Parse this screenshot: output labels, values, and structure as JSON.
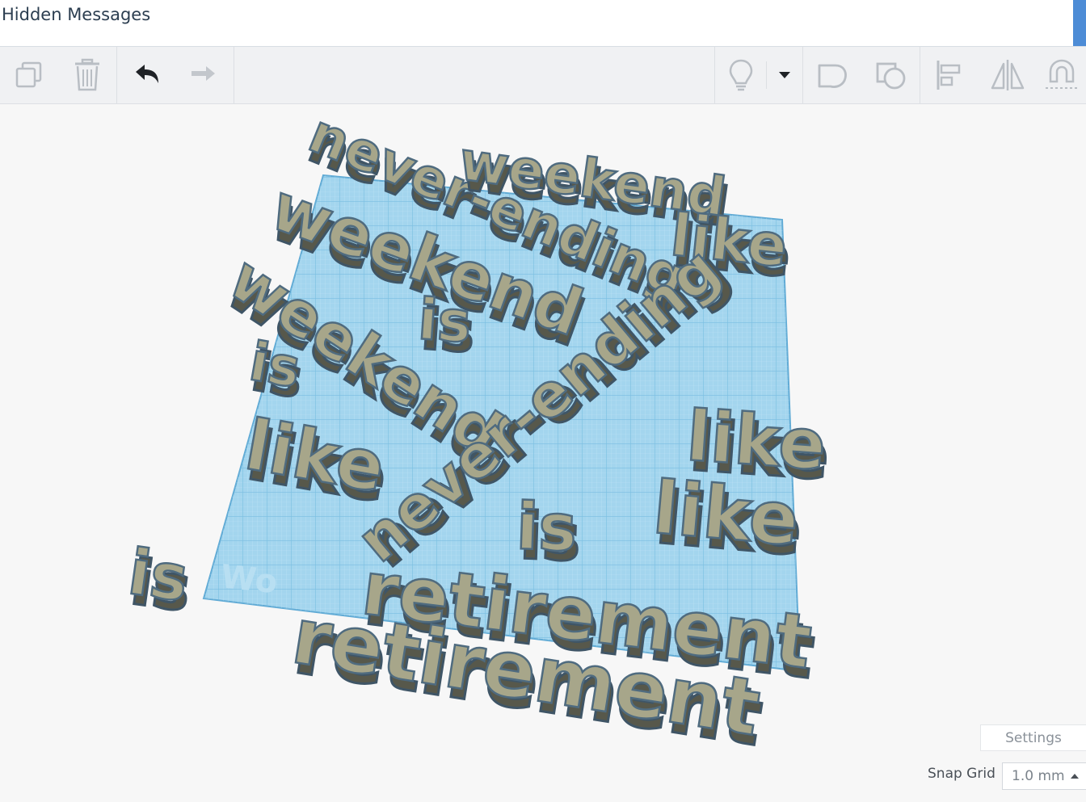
{
  "window": {
    "title": "Hidden Messages"
  },
  "toolbar": {
    "copy_icon": "copy-icon",
    "delete_icon": "trash-icon",
    "undo_icon": "undo-arrow-icon",
    "redo_icon": "redo-arrow-icon",
    "notes_icon": "lightbulb-icon",
    "dropdown_icon": "caret-down-icon",
    "group_icon": "group-shape-icon",
    "ungroup_icon": "ungroup-shape-icon",
    "align_icon": "align-icon",
    "mirror_icon": "mirror-icon",
    "cruise_icon": "magnet-icon"
  },
  "scene": {
    "plane_color": "#9fd4ee",
    "text_fill": "#a7a68a",
    "text_outline": "#4f6b7f",
    "words": [
      "never-ending",
      "weekend",
      "like",
      "weekend",
      "is",
      "weekend",
      "never-ending",
      "is",
      "like",
      "like",
      "like",
      "is",
      "is",
      "retirement",
      "retirement"
    ],
    "plane_watermark": "Wo"
  },
  "panel": {
    "settings_label": "Settings",
    "snap_grid_label": "Snap Grid",
    "snap_grid_value": "1.0 mm"
  }
}
